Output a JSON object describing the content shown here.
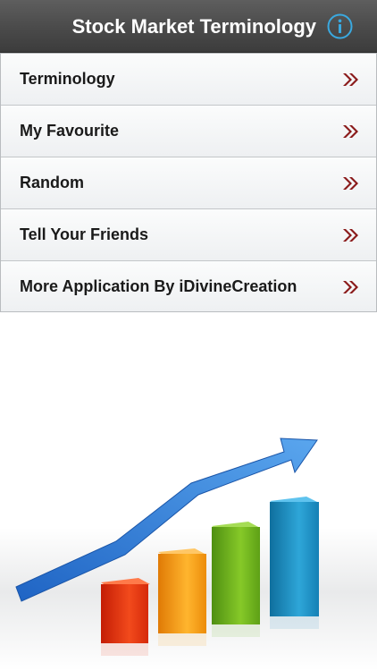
{
  "header": {
    "title": "Stock Market Terminology",
    "info_icon": "info-circle-icon"
  },
  "menu": {
    "items": [
      {
        "label": "Terminology"
      },
      {
        "label": "My Favourite"
      },
      {
        "label": "Random"
      },
      {
        "label": "Tell Your Friends"
      },
      {
        "label": "More Application By iDivineCreation"
      }
    ],
    "chevron_icon": "double-chevron-right-icon",
    "chevron_color": "#8a1a1a"
  },
  "colors": {
    "nav_bg": "#4a4a4a",
    "info_accent": "#3aa9e0",
    "bar_red": "#e8320e",
    "bar_orange": "#f59a0c",
    "bar_green": "#6fb21f",
    "bar_blue": "#1f8fc4",
    "arrow_blue": "#2d7fd6"
  }
}
